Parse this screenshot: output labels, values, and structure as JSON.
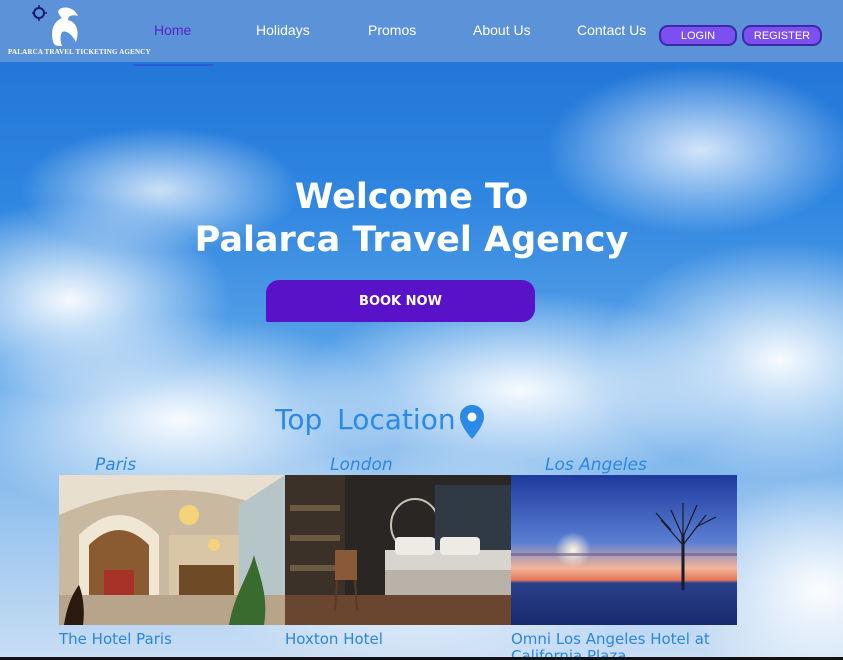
{
  "nav": {
    "logo_text": "PALARCA TRAVEL TICKETING AGENCY",
    "links": [
      {
        "label": "Home"
      },
      {
        "label": "Holidays"
      },
      {
        "label": "Promos"
      },
      {
        "label": "About Us"
      },
      {
        "label": "Contact Us"
      }
    ],
    "login_label": "LOGIN",
    "register_label": "REGISTER"
  },
  "hero": {
    "title_line1": "Welcome To",
    "title_line2": "Palarca Travel Agency",
    "book_label": "BOOK NOW"
  },
  "top_location": {
    "title": "Top  Location",
    "icon": "map-pin-icon",
    "items": [
      {
        "city": "Paris",
        "hotel": "The Hotel Paris"
      },
      {
        "city": "London",
        "hotel": "Hoxton Hotel"
      },
      {
        "city": "Los Angeles",
        "hotel": "Omni Los Angeles Hotel at California Plaza"
      }
    ]
  },
  "colors": {
    "nav_bg": "#5b92d8",
    "active_link": "#5a24c8",
    "button_purple": "#5a12c8",
    "pill_purple": "#7c4ff0",
    "accent_blue": "#2b8ae6"
  }
}
